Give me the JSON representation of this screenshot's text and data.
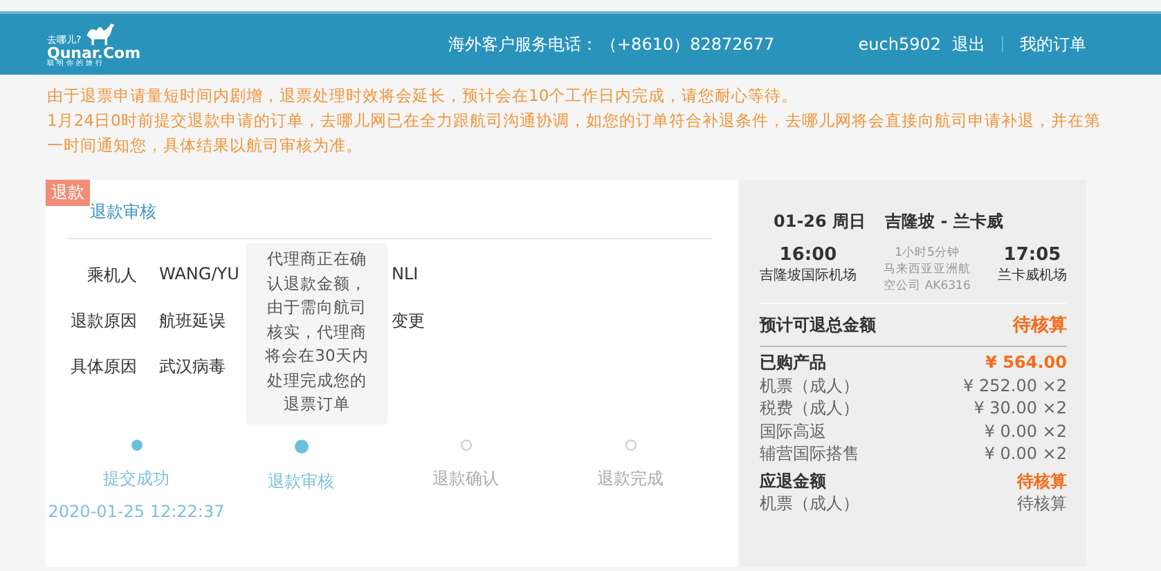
{
  "header": {
    "logo_top": "去哪儿?",
    "logo_main": "Qunar.Com",
    "logo_sub": "聪明你的旅行",
    "hotline_label": "海外客户服务电话：",
    "hotline": "（+8610）82872677",
    "username": "euch5902",
    "logout": "退出",
    "my_orders": "我的订单"
  },
  "notice": [
    "由于退票申请量短时间内剧增，退票处理时效将会延长，预计会在10个工作日内完成，请您耐心等待。",
    "1月24日0时前提交退款申请的订单，去哪儿网已在全力跟航司沟通协调，如您的订单符合补退条件，去哪儿网将会直接向航司申请补退，并在第一时间通知您，具体结果以航司审核为准。"
  ],
  "refund": {
    "tag": "退款",
    "title": "退款审核",
    "fields": [
      {
        "label": "乘机人",
        "value_start": "WANG/YU",
        "value_end": "NLI"
      },
      {
        "label": "退款原因",
        "value_start": "航班延误",
        "value_end": "变更"
      },
      {
        "label": "具体原因",
        "value_start": "武汉病毒"
      }
    ],
    "tooltip": "代理商正在确认退款金额，由于需向航司核实，代理商将会在30天内处理完成您的退票订单",
    "steps": [
      {
        "label": "提交成功",
        "done": true,
        "current": false,
        "time": "2020-01-25 12:22:37"
      },
      {
        "label": "退款审核",
        "done": true,
        "current": true
      },
      {
        "label": "退款确认",
        "done": false,
        "current": false
      },
      {
        "label": "退款完成",
        "done": false,
        "current": false
      }
    ]
  },
  "flight": {
    "date": "01-26 周日",
    "route": "吉隆坡 - 兰卡威",
    "depart_time": "16:00",
    "depart_airport": "吉隆坡国际机场",
    "duration": "1小时5分钟",
    "airline": "马来西亚亚洲航空公司 AK6316",
    "arrive_time": "17:05",
    "arrive_airport": "兰卡威机场"
  },
  "summary": {
    "estimate_label": "预计可退总金额",
    "estimate_value": "待核算",
    "sections": [
      {
        "label": "已购产品",
        "value": "¥ 564.00",
        "items": [
          {
            "label": "机票（成人）",
            "value": "¥ 252.00 ×2"
          },
          {
            "label": "税费（成人）",
            "value": "¥ 30.00 ×2"
          },
          {
            "label": "国际高返",
            "value": "¥ 0.00 ×2"
          },
          {
            "label": "辅营国际搭售",
            "value": "¥ 0.00 ×2"
          }
        ]
      },
      {
        "label": "应退金额",
        "value": "待核算",
        "items": [
          {
            "label": "机票（成人）",
            "value": "待核算"
          }
        ]
      }
    ]
  }
}
